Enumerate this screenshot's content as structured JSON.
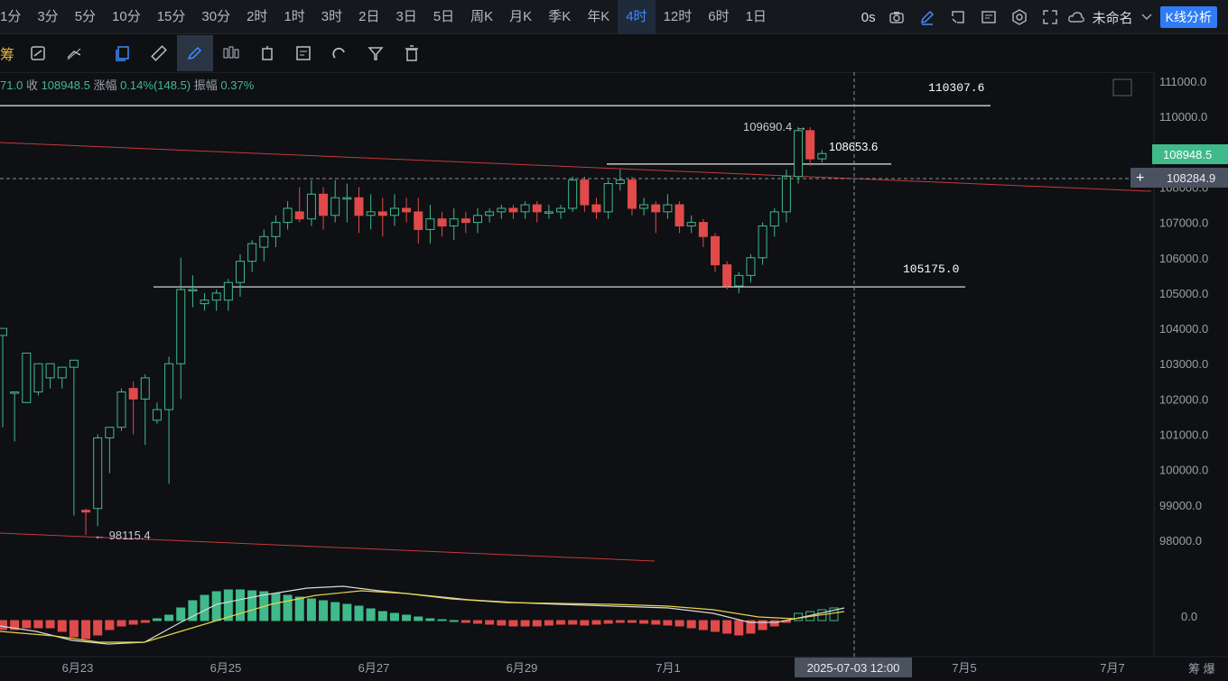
{
  "timeframes": [
    "1分",
    "3分",
    "5分",
    "10分",
    "15分",
    "30分",
    "2时",
    "1时",
    "3时",
    "2日",
    "3日",
    "5日",
    "周K",
    "月K",
    "季K",
    "年K",
    "4时",
    "12时",
    "6时",
    "1日"
  ],
  "active_timeframe": "4时",
  "toolbar_right": {
    "countdown": "0s",
    "layout_name": "未命名",
    "kline_button": "K线分析"
  },
  "drawbar": {
    "left_label": "筹"
  },
  "info_line": {
    "open_tail": "71.0",
    "close_label": "收",
    "close_value": "108948.5",
    "change_label": "涨幅",
    "change_value": "0.14%(148.5)",
    "amp_label": "振幅",
    "amp_value": "0.37%"
  },
  "colors": {
    "up": "#3fba8a",
    "down": "#e04a4a",
    "accent": "#2f7cf6",
    "background": "#0e1013",
    "trend": "#c43a3a",
    "dif": "#d9d9d9",
    "dea": "#e8d34a"
  },
  "chart_data": {
    "type": "candlestick",
    "interval": "4时",
    "y_axis": {
      "min": 97500,
      "max": 111250,
      "ticks": [
        98000,
        99000,
        100000,
        101000,
        102000,
        103000,
        104000,
        105000,
        106000,
        107000,
        108000,
        109000,
        110000,
        111000
      ]
    },
    "x_labels": [
      "6月23",
      "6月25",
      "6月27",
      "6月29",
      "7月1",
      "7月5",
      "7月7"
    ],
    "crosshair": {
      "date": "2025-07-03 12:00",
      "price": "108284.9"
    },
    "last_price": "108948.5",
    "horizontal_lines": [
      {
        "value": 110307.6,
        "label": "110307.6"
      },
      {
        "value": 105175.0,
        "label": "105175.0"
      },
      {
        "value": 108653.6,
        "label": "108653.6"
      }
    ],
    "annotations": [
      {
        "label": "109690.4",
        "kind": "high"
      },
      {
        "label": "98115.4",
        "kind": "low"
      }
    ],
    "candles": [
      [
        103800,
        104000,
        102300,
        102200,
        101200
      ],
      [
        102200,
        102200,
        101900,
        102000,
        100800
      ],
      [
        101900,
        103300,
        101700,
        102300,
        102200
      ],
      [
        102200,
        103000,
        102300,
        102600,
        102100
      ],
      [
        102600,
        103000,
        102500,
        102700,
        102300
      ],
      [
        102600,
        102900,
        102500,
        102900,
        102300
      ],
      [
        102900,
        103100,
        98900,
        98800,
        98700
      ],
      [
        98850,
        98800,
        98800,
        98900,
        98150
      ],
      [
        98900,
        100900,
        98600,
        101000,
        98400
      ],
      [
        100900,
        101200,
        100900,
        101200,
        99900
      ],
      [
        101200,
        102200,
        101000,
        102300,
        101100
      ],
      [
        102300,
        102000,
        101300,
        102500,
        101000
      ],
      [
        102000,
        102600,
        101300,
        102700,
        100700
      ],
      [
        101400,
        101700,
        101400,
        101900,
        101300
      ],
      [
        101700,
        103000,
        101600,
        103200,
        99600
      ],
      [
        103000,
        105100,
        102900,
        106000,
        102000
      ],
      [
        105100,
        105100,
        104700,
        105500,
        104600
      ],
      [
        104700,
        104800,
        104700,
        105000,
        104500
      ],
      [
        104800,
        105000,
        104700,
        105100,
        104500
      ],
      [
        104800,
        105300,
        104800,
        105400,
        104500
      ],
      [
        105300,
        105900,
        105200,
        106100,
        104900
      ],
      [
        105900,
        106400,
        105800,
        106500,
        105600
      ],
      [
        106300,
        106600,
        106100,
        106800,
        105900
      ],
      [
        106600,
        107000,
        106500,
        107200,
        106300
      ],
      [
        107000,
        107400,
        106900,
        107600,
        106800
      ],
      [
        107300,
        107100,
        107100,
        108000,
        107000
      ],
      [
        107100,
        107800,
        107000,
        108200,
        106900
      ],
      [
        107800,
        107200,
        107000,
        108000,
        106800
      ],
      [
        107200,
        107700,
        107100,
        108200,
        107000
      ],
      [
        107700,
        107700,
        107300,
        108100,
        107000
      ],
      [
        107700,
        107200,
        107100,
        108000,
        106700
      ],
      [
        107200,
        107300,
        107100,
        107800,
        106800
      ],
      [
        107300,
        107200,
        107000,
        107700,
        106600
      ],
      [
        107200,
        107400,
        107100,
        107800,
        106900
      ],
      [
        107400,
        107300,
        107100,
        107700,
        107000
      ],
      [
        107300,
        106800,
        106800,
        107700,
        106400
      ],
      [
        106800,
        107100,
        106700,
        107500,
        106400
      ],
      [
        107100,
        106900,
        106800,
        107300,
        106600
      ],
      [
        106900,
        107100,
        106800,
        107400,
        106500
      ],
      [
        107100,
        107000,
        106900,
        107300,
        106700
      ],
      [
        107000,
        107200,
        106900,
        107400,
        106700
      ],
      [
        107200,
        107300,
        107100,
        107400,
        107000
      ],
      [
        107300,
        107400,
        107200,
        107500,
        107100
      ],
      [
        107400,
        107300,
        107200,
        107500,
        107100
      ],
      [
        107300,
        107500,
        107200,
        107600,
        107100
      ],
      [
        107500,
        107300,
        107200,
        107600,
        107000
      ],
      [
        107300,
        107300,
        107200,
        107500,
        107100
      ],
      [
        107300,
        107400,
        107200,
        107500,
        107100
      ],
      [
        107400,
        108200,
        107400,
        108300,
        107300
      ],
      [
        108200,
        107500,
        107400,
        108300,
        107300
      ],
      [
        107500,
        107300,
        107200,
        107700,
        107100
      ],
      [
        107300,
        108100,
        107200,
        108200,
        107100
      ],
      [
        108100,
        108200,
        108000,
        108500,
        107900
      ],
      [
        108200,
        107400,
        107200,
        108300,
        107200
      ],
      [
        107400,
        107500,
        107300,
        107700,
        107200
      ],
      [
        107500,
        107300,
        107100,
        107600,
        106700
      ],
      [
        107300,
        107500,
        107200,
        107800,
        107100
      ],
      [
        107500,
        106900,
        106800,
        107600,
        106700
      ],
      [
        106900,
        107000,
        106900,
        107200,
        106700
      ],
      [
        107000,
        106600,
        106500,
        107100,
        106300
      ],
      [
        106600,
        105800,
        105700,
        106700,
        105600
      ],
      [
        105800,
        105200,
        105100,
        105900,
        105100
      ],
      [
        105200,
        105500,
        105100,
        105600,
        105000
      ],
      [
        105500,
        106000,
        105400,
        106100,
        105300
      ],
      [
        106000,
        106900,
        105900,
        107000,
        105800
      ],
      [
        106900,
        107300,
        106800,
        107400,
        106600
      ],
      [
        107300,
        108300,
        107200,
        108500,
        107000
      ],
      [
        108300,
        109600,
        108200,
        109700,
        108100
      ],
      [
        109600,
        108800,
        108700,
        109700,
        108600
      ],
      [
        108800,
        108950,
        108800,
        109050,
        108700
      ]
    ],
    "macd": {
      "dif_desc": "white",
      "dea_desc": "yellow"
    }
  }
}
